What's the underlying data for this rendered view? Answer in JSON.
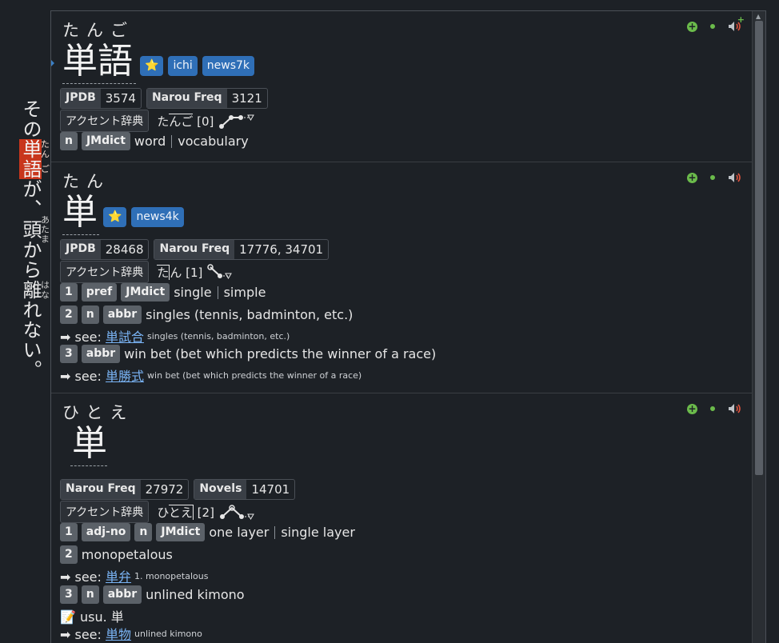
{
  "source_text": {
    "before": "その",
    "highlight": [
      {
        "base": "単",
        "rt": "たん"
      },
      {
        "base": "語",
        "rt": "ご"
      }
    ],
    "after1": "が、",
    "ruby2": [
      {
        "base": "頭",
        "rt": "あたま"
      }
    ],
    "after2": "から",
    "ruby3": [
      {
        "base": "離",
        "rt": "はな"
      }
    ],
    "after3": "れない。"
  },
  "entries": [
    {
      "reading": "たんご",
      "expression": "単語",
      "tags": [
        "⭐",
        "ichi",
        "news7k"
      ],
      "freq": [
        {
          "k": "JPDB",
          "v": "3574"
        },
        {
          "k": "Narou Freq",
          "v": "3121"
        }
      ],
      "accent": {
        "label": "アクセント辞典",
        "kana_a": "た",
        "kana_b": "んご",
        "num": "[0]"
      },
      "senses": [
        {
          "pills": [
            "n",
            "JMdict"
          ],
          "glosses": [
            "word",
            "vocabulary"
          ]
        }
      ]
    },
    {
      "reading": "たん",
      "expression": "単",
      "tags": [
        "⭐",
        "news4k"
      ],
      "freq": [
        {
          "k": "JPDB",
          "v": "28468"
        },
        {
          "k": "Narou Freq",
          "v": "17776, 34701"
        }
      ],
      "accent": {
        "label": "アクセント辞典",
        "kana_a": "た",
        "kana_b": "ん",
        "num": "[1]"
      },
      "senses": [
        {
          "num": "1",
          "pills": [
            "pref",
            "JMdict"
          ],
          "glosses": [
            "single",
            "simple"
          ]
        },
        {
          "num": "2",
          "pills": [
            "n",
            "abbr"
          ],
          "glosses": [
            "singles (tennis, badminton, etc.)"
          ],
          "see": {
            "prefix": "➡ see: ",
            "link": "単試合",
            "note": "singles (tennis, badminton, etc.)"
          }
        },
        {
          "num": "3",
          "pills": [
            "abbr"
          ],
          "glosses": [
            "win bet (bet which predicts the winner of a race)"
          ],
          "see": {
            "prefix": "➡ see: ",
            "link": "単勝式",
            "note": "win bet (bet which predicts the winner of a race)"
          }
        }
      ]
    },
    {
      "reading": "ひとえ",
      "expression": "単",
      "tags": [],
      "freq": [
        {
          "k": "Narou Freq",
          "v": "27972"
        },
        {
          "k": "Novels",
          "v": "14701"
        }
      ],
      "accent": {
        "label": "アクセント辞典",
        "kana_a": "ひ",
        "kana_b": "とえ",
        "num": "[2]"
      },
      "senses": [
        {
          "num": "1",
          "pills": [
            "adj-no",
            "n",
            "JMdict"
          ],
          "glosses": [
            "one layer",
            "single layer"
          ]
        },
        {
          "num": "2",
          "pills": [],
          "glosses": [
            "monopetalous"
          ],
          "see": {
            "prefix": "➡ see: ",
            "link": "単弁",
            "note": "1. monopetalous"
          }
        },
        {
          "num": "3",
          "pills": [
            "n",
            "abbr"
          ],
          "glosses": [
            "unlined kimono"
          ],
          "note": "📝 usu. 単",
          "see": {
            "prefix": "➡ see: ",
            "link": "単物",
            "note": "unlined kimono"
          }
        }
      ]
    }
  ],
  "colors": {
    "accent": "#2f6fb7",
    "highlight": "#c8361c",
    "link": "#7ab4f5",
    "add": "#6bbb4b"
  }
}
